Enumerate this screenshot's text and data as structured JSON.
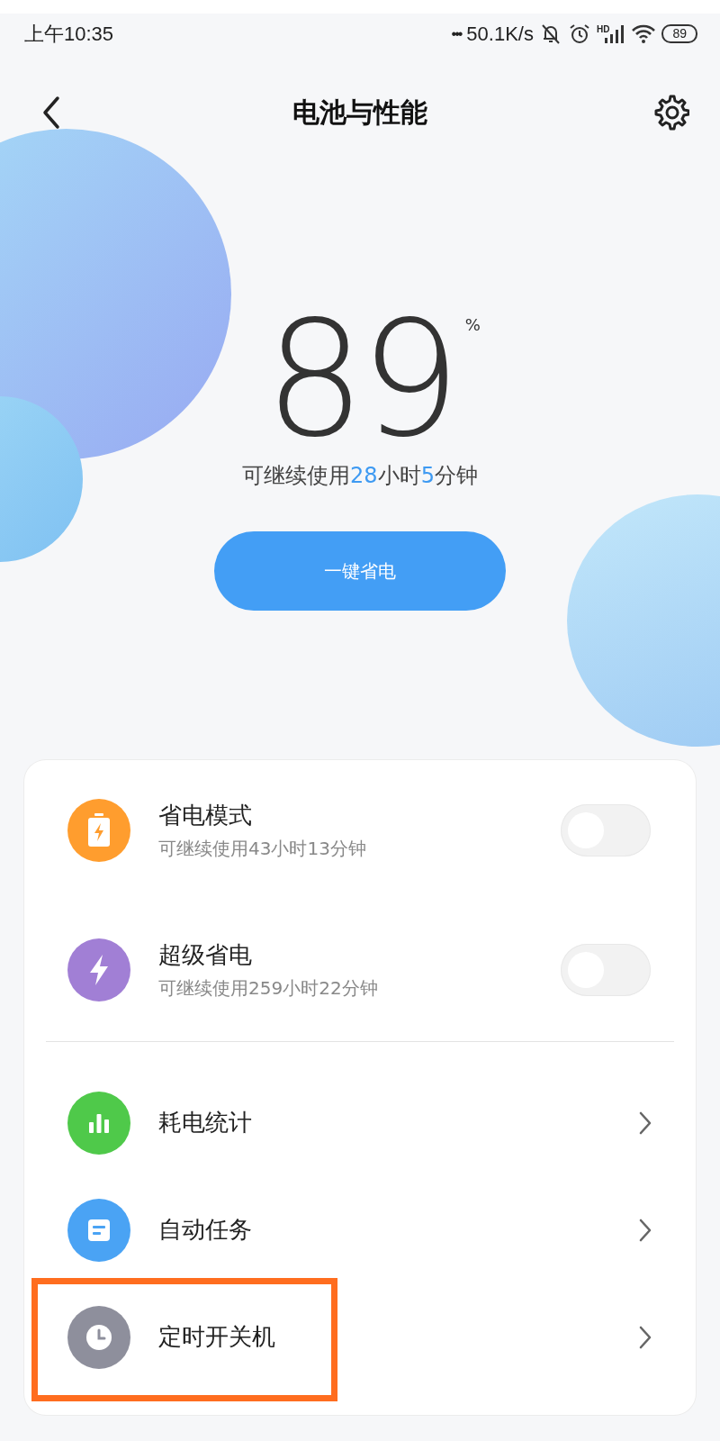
{
  "status_bar": {
    "time": "上午10:35",
    "dots": "•••",
    "net_speed": "50.1K/s",
    "signal_label": "HD",
    "battery": "89"
  },
  "header": {
    "title": "电池与性能"
  },
  "battery": {
    "percent": "89",
    "unit": "%",
    "remaining": [
      {
        "text": "可继续使用",
        "highlight": false
      },
      {
        "text": "28",
        "highlight": true
      },
      {
        "text": "小时",
        "highlight": false
      },
      {
        "text": "5",
        "highlight": true
      },
      {
        "text": "分钟",
        "highlight": false
      }
    ]
  },
  "save_button": {
    "label": "一键省电"
  },
  "items": [
    {
      "kind": "toggle",
      "title": "省电模式",
      "subtitle": "可继续使用43小时13分钟",
      "color": "#ff9d2e",
      "on": false,
      "highlighted": false
    },
    {
      "kind": "toggle",
      "title": "超级省电",
      "subtitle": "可继续使用259小时22分钟",
      "color": "#a17fd5",
      "on": false,
      "highlighted": false
    },
    {
      "kind": "link",
      "title": "耗电统计",
      "color": "#4fc94a",
      "highlighted": false
    },
    {
      "kind": "link",
      "title": "自动任务",
      "color": "#4aa3f4",
      "highlighted": false
    },
    {
      "kind": "link",
      "title": "定时开关机",
      "color": "#8e8f9c",
      "highlighted": true
    }
  ]
}
